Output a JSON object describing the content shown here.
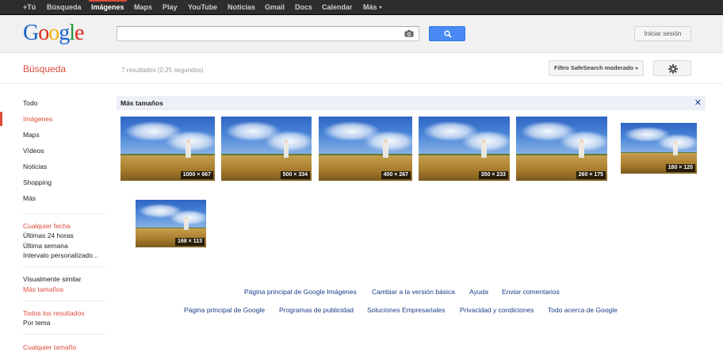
{
  "topbar": {
    "items": [
      {
        "label": "+Tú",
        "active": false
      },
      {
        "label": "Búsqueda",
        "active": false
      },
      {
        "label": "Imágenes",
        "active": true
      },
      {
        "label": "Maps",
        "active": false
      },
      {
        "label": "Play",
        "active": false
      },
      {
        "label": "YouTube",
        "active": false
      },
      {
        "label": "Noticias",
        "active": false
      },
      {
        "label": "Gmail",
        "active": false
      },
      {
        "label": "Docs",
        "active": false
      },
      {
        "label": "Calendar",
        "active": false
      },
      {
        "label": "Más",
        "active": false
      }
    ]
  },
  "header": {
    "logo_letters": [
      "G",
      "o",
      "o",
      "g",
      "l",
      "e"
    ],
    "search_value": "",
    "signin_label": "Iniciar sesión"
  },
  "subheader": {
    "title": "Búsqueda",
    "result_stats": "7 resultados (0,25 segundos)",
    "safesearch_label": "Filtro SafeSearch moderado"
  },
  "leftnav": {
    "types": [
      "Todo",
      "Imágenes",
      "Maps",
      "Vídeos",
      "Noticias",
      "Shopping",
      "Más"
    ],
    "active_index": 1,
    "date_heading": "Cualquier fecha",
    "date_options": [
      "Últimas 24 horas",
      "Última semana",
      "Intervalo personalizado..."
    ],
    "similar_label": "Visualmente similar",
    "more_sizes_label": "Más tamaños",
    "all_results_heading": "Todos los resultados",
    "by_topic_label": "Por tema",
    "any_size_heading": "Cualquier tamaño"
  },
  "results": {
    "heading": "Más tamaños",
    "close_glyph": "✕",
    "thumbnails": [
      {
        "size": "1000 × 667"
      },
      {
        "size": "500 × 334"
      },
      {
        "size": "400 × 267"
      },
      {
        "size": "350 × 233"
      },
      {
        "size": "260 × 175"
      },
      {
        "size": "180 × 120"
      },
      {
        "size": "168 × 113"
      }
    ]
  },
  "footer": {
    "row1": [
      "Página principal de Google Imágenes",
      "Cambiar a la versión básica",
      "Ayuda",
      "Enviar comentarios"
    ],
    "row2": [
      "Página principal de Google",
      "Programas de publicidad",
      "Soluciones Empresariales",
      "Privacidad y condiciones",
      "Todo acerca de Google"
    ]
  },
  "colors": {
    "accent_red": "#dd4b39",
    "link_blue": "#1a3d87",
    "search_blue": "#4a8af4"
  }
}
